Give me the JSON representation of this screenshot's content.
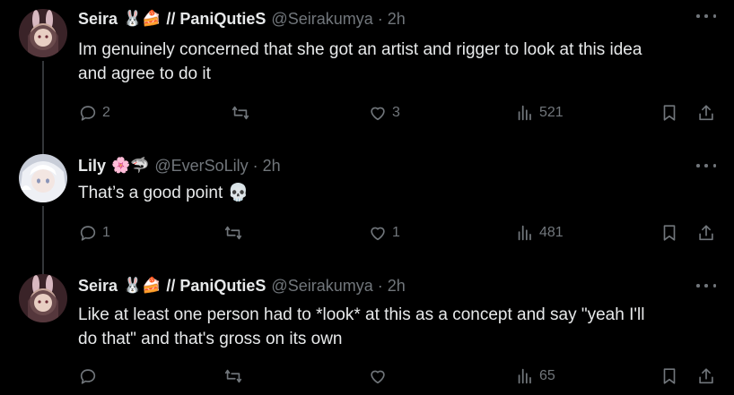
{
  "tweets": [
    {
      "name": "Seira",
      "emojis": "🐰🍰",
      "display_suffix": "// PaniQutieS",
      "handle": "@Seirakumya",
      "time": "2h",
      "text": "Im genuinely concerned that she got an artist and rigger to look at this idea\nand agree to do it",
      "replies": "2",
      "reposts": "",
      "likes": "3",
      "views": "521"
    },
    {
      "name": "Lily",
      "emojis": "🌸🦈",
      "display_suffix": "",
      "handle": "@EverSoLily",
      "time": "2h",
      "text": "That’s a good point 💀",
      "replies": "1",
      "reposts": "",
      "likes": "1",
      "views": "481"
    },
    {
      "name": "Seira",
      "emojis": "🐰🍰",
      "display_suffix": "// PaniQutieS",
      "handle": "@Seirakumya",
      "time": "2h",
      "text": "Like at least one person had to *look* at this as a concept and say \"yeah I'll\ndo that\" and that's gross on its own",
      "replies": "",
      "reposts": "",
      "likes": "",
      "views": "65"
    }
  ],
  "icons": {
    "reply": "reply-icon",
    "repost": "repost-icon",
    "like": "heart-icon",
    "views": "views-icon",
    "bookmark": "bookmark-icon",
    "share": "share-icon",
    "more": "more-icon"
  },
  "colors": {
    "background": "#000000",
    "text": "#e7e9ea",
    "muted": "#71767b",
    "thread_line": "#333639"
  }
}
